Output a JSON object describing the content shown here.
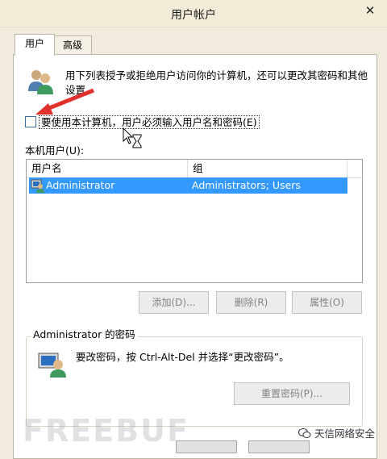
{
  "window": {
    "title": "用户帐户",
    "close_glyph": "✕"
  },
  "tabs": [
    {
      "label": "用户",
      "active": true
    },
    {
      "label": "高级",
      "active": false
    }
  ],
  "users_tab": {
    "description": "用下列表授予或拒绝用户访问你的计算机，还可以更改其密码和其他设置。",
    "require_password_checkbox": {
      "label": "要使用本计算机，用户必须输入用户名和密码(E)",
      "checked": false
    },
    "local_users_label": "本机用户(U):",
    "columns": [
      "用户名",
      "组"
    ],
    "users": [
      {
        "username": "Administrator",
        "groups": "Administrators; Users",
        "selected": true
      }
    ],
    "buttons": {
      "add": "添加(D)...",
      "remove": "删除(R)",
      "properties": "属性(O)"
    },
    "password_group": {
      "title": "Administrator 的密码",
      "description": "要改密码，按 Ctrl-Alt-Del 并选择“更改密码”。",
      "reset_button": "重置密码(P)..."
    }
  },
  "watermarks": {
    "left": "FREEBUF",
    "right": "天信网络安全"
  },
  "colors": {
    "selection": "#3399ff",
    "annotation_arrow": "#e0312b",
    "disabled_text": "#838383"
  }
}
